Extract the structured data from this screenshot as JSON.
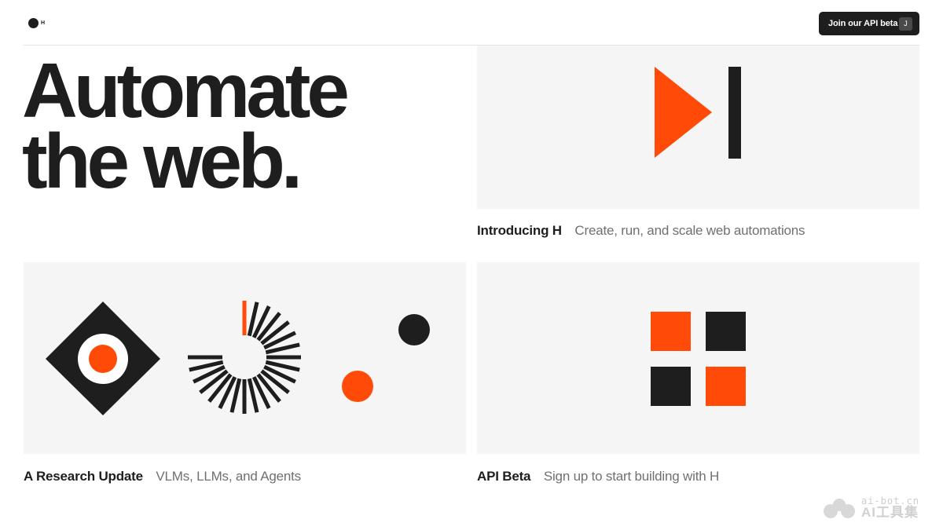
{
  "header": {
    "logo_letter": "H",
    "cta_label": "Join our API beta",
    "cta_shortcut": "J"
  },
  "hero": {
    "line1": "Automate",
    "line2": "the web."
  },
  "cards": [
    {
      "title": "Introducing H",
      "description": "Create, run, and scale web automations"
    },
    {
      "title": "A Research Update",
      "description": "VLMs, LLMs, and Agents"
    },
    {
      "title": "API Beta",
      "description": "Sign up to start building with H"
    }
  ],
  "watermark": {
    "domain": "ai-bot.cn",
    "name": "AI工具集"
  },
  "colors": {
    "accent": "#ff4b07",
    "dark": "#1e1e1e",
    "card_bg": "#f5f5f5",
    "muted_text": "#707070"
  }
}
